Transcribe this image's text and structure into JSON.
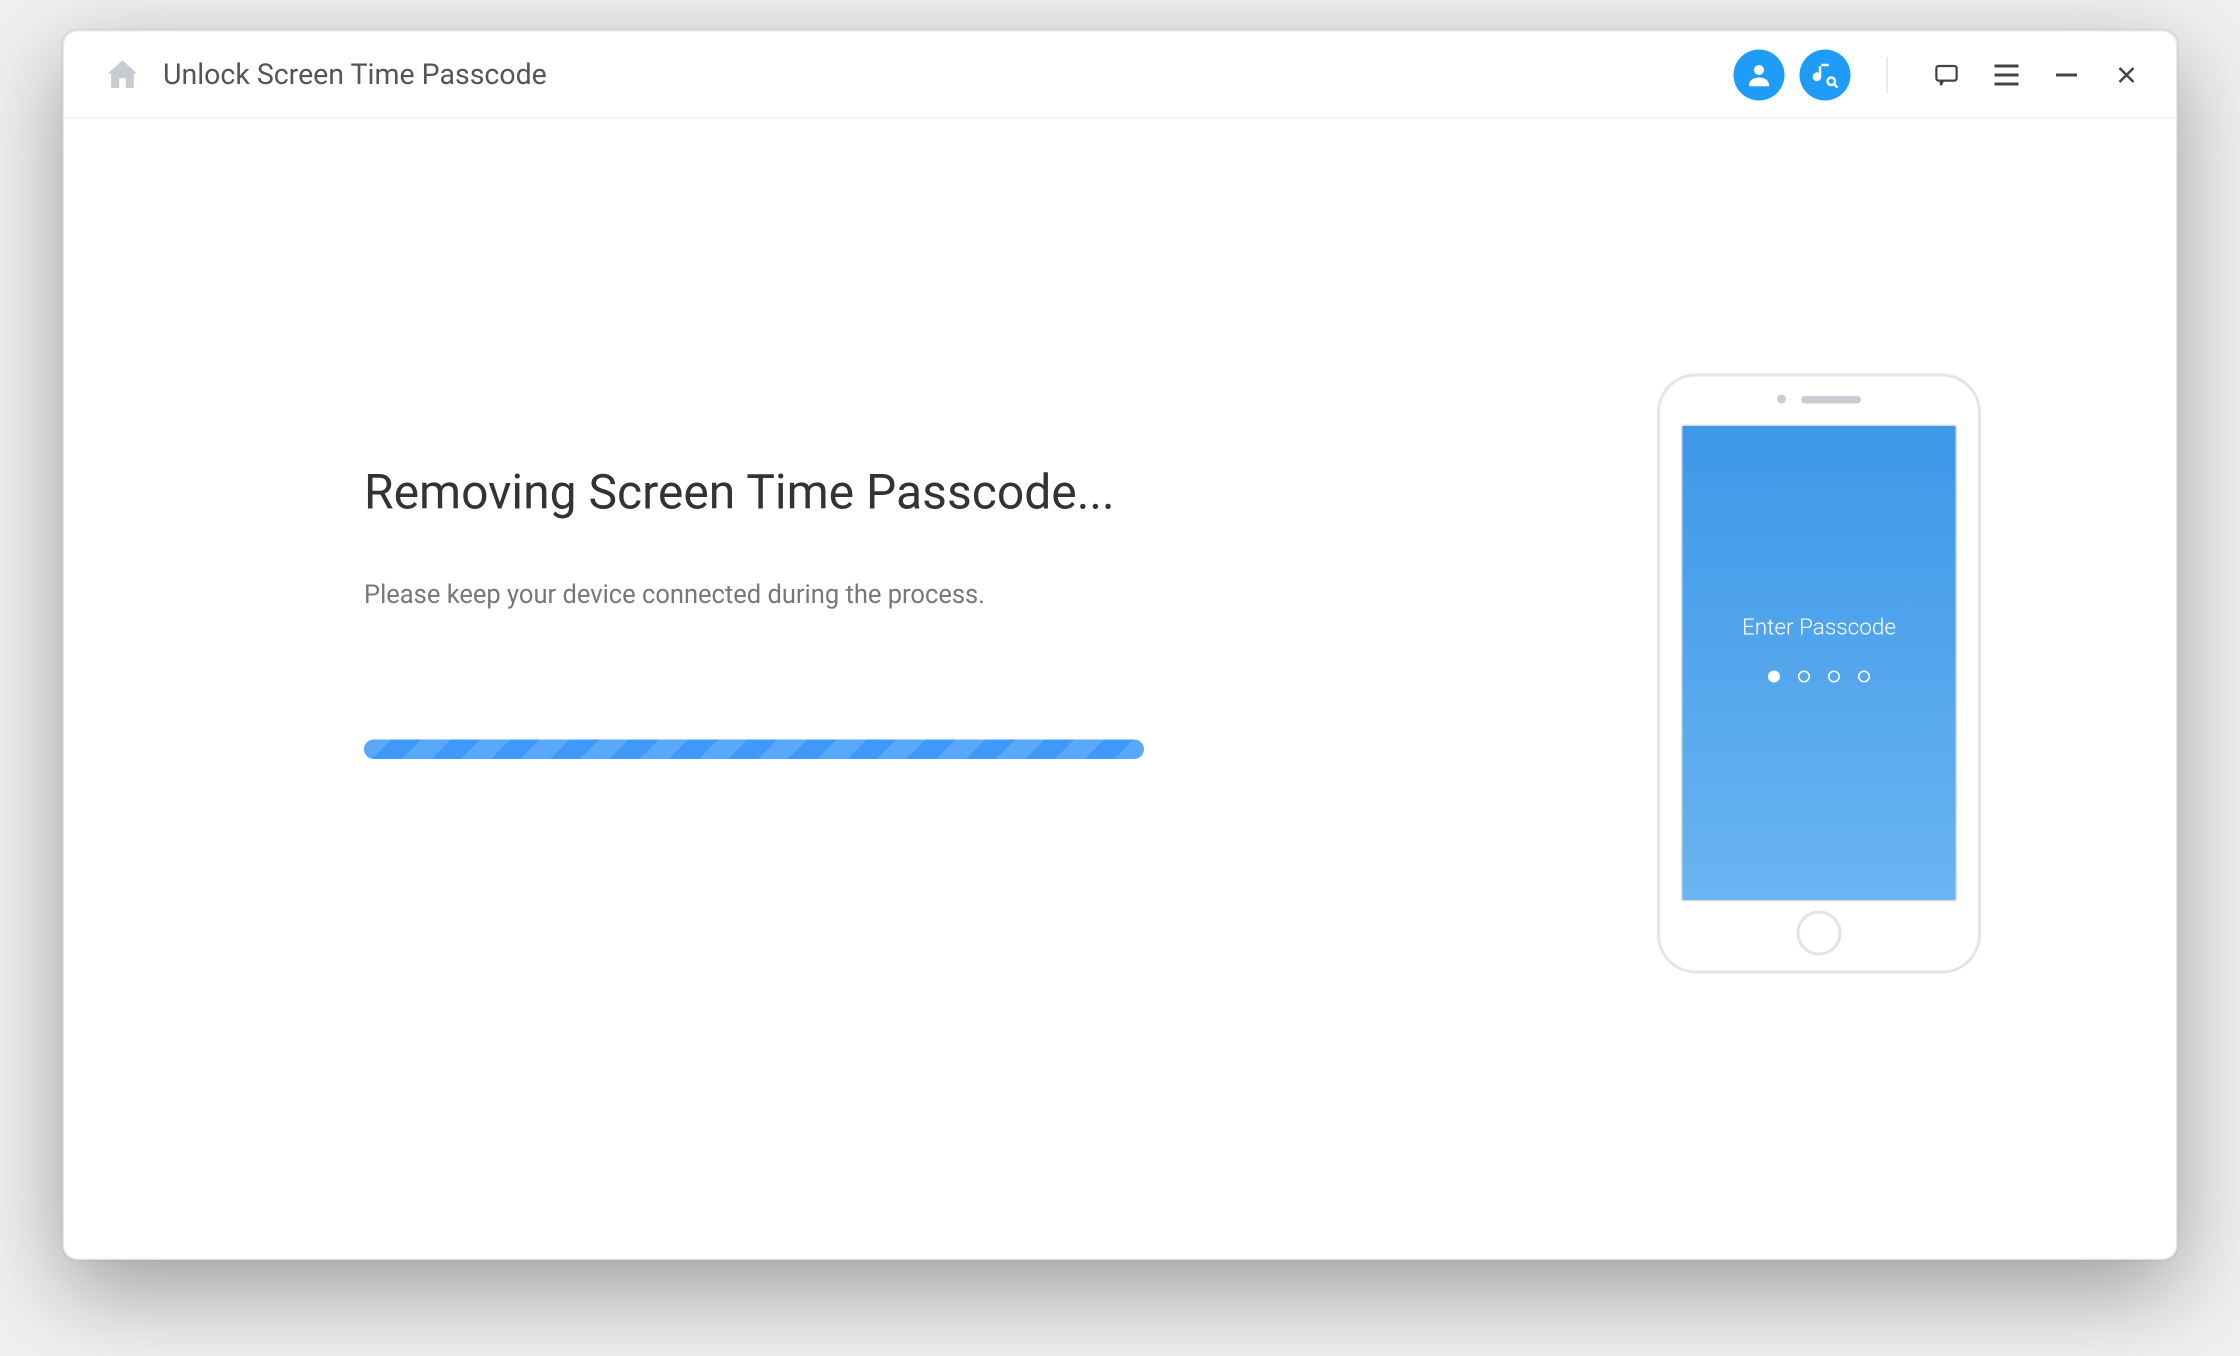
{
  "header": {
    "title": "Unlock Screen Time Passcode"
  },
  "main": {
    "heading": "Removing Screen Time Passcode...",
    "subtext": "Please keep your device connected during the process."
  },
  "device": {
    "screen_label": "Enter Passcode"
  }
}
